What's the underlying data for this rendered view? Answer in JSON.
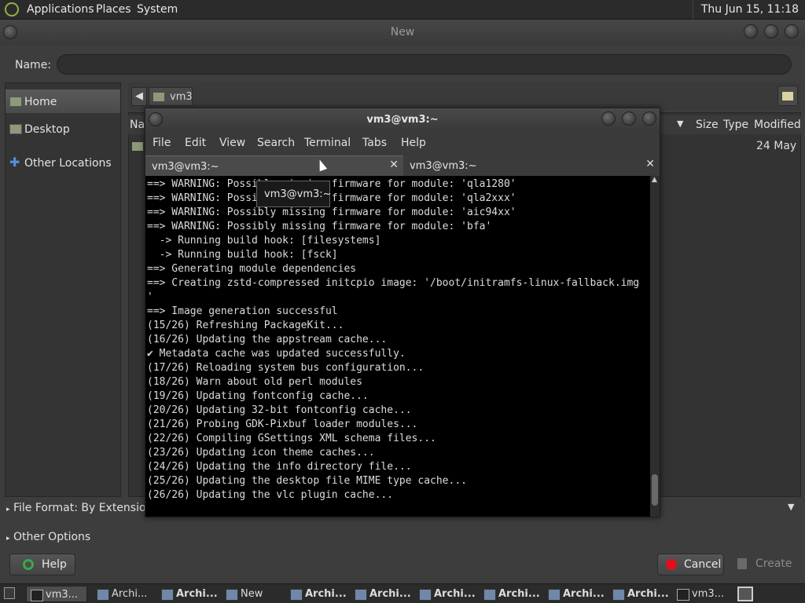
{
  "top_panel": {
    "menus": [
      "Applications",
      "Places",
      "System"
    ],
    "clock": "Thu Jun 15, 11:18"
  },
  "dialog": {
    "title": "New",
    "name_label": "Name:",
    "name_value": "",
    "places": [
      {
        "label": "Home",
        "selected": true
      },
      {
        "label": "Desktop",
        "selected": false
      },
      {
        "label": "Other Locations",
        "selected": false
      }
    ],
    "path_segment": "vm3",
    "columns": {
      "name": "Na",
      "size": "Size",
      "type": "Type",
      "modified": "Modified"
    },
    "file_row_modified": "24 May",
    "file_format_label": "File Format: By Extension",
    "other_options_label": "Other Options",
    "help_label": "Help",
    "cancel_label": "Cancel",
    "create_label": "Create"
  },
  "terminal": {
    "title": "vm3@vm3:~",
    "menus": [
      "File",
      "Edit",
      "View",
      "Search",
      "Terminal",
      "Tabs",
      "Help"
    ],
    "tabs": [
      {
        "label": "vm3@vm3:~",
        "active": true
      },
      {
        "label": "vm3@vm3:~",
        "active": false
      }
    ],
    "tooltip": "vm3@vm3:~",
    "lines": [
      "==> WARNING: Possibly missing firmware for module: 'qla1280'",
      "==> WARNING: Possibly missing firmware for module: 'qla2xxx'",
      "==> WARNING: Possibly missing firmware for module: 'aic94xx'",
      "==> WARNING: Possibly missing firmware for module: 'bfa'",
      "  -> Running build hook: [filesystems]",
      "  -> Running build hook: [fsck]",
      "==> Generating module dependencies",
      "==> Creating zstd-compressed initcpio image: '/boot/initramfs-linux-fallback.img",
      "'",
      "==> Image generation successful",
      "(15/26) Refreshing PackageKit...",
      "(16/26) Updating the appstream cache...",
      "✔ Metadata cache was updated successfully.",
      "(17/26) Reloading system bus configuration...",
      "(18/26) Warn about old perl modules",
      "(19/26) Updating fontconfig cache...",
      "(20/26) Updating 32-bit fontconfig cache...",
      "(21/26) Probing GDK-Pixbuf loader modules...",
      "(22/26) Compiling GSettings XML schema files...",
      "(23/26) Updating icon theme caches...",
      "(24/26) Updating the info directory file...",
      "(25/26) Updating the desktop file MIME type cache...",
      "(26/26) Updating the vlc plugin cache..."
    ]
  },
  "taskbar": [
    {
      "label": "vm3...",
      "icon": "terminal-icon",
      "bold": false,
      "selected": true
    },
    {
      "label": "Archi...",
      "icon": "window-icon",
      "bold": false,
      "selected": false
    },
    {
      "label": "Archi...",
      "icon": "window-icon",
      "bold": true,
      "selected": false
    },
    {
      "label": "New",
      "icon": "window-icon",
      "bold": false,
      "selected": false
    },
    {
      "label": "Archi...",
      "icon": "window-icon",
      "bold": true,
      "selected": false
    },
    {
      "label": "Archi...",
      "icon": "window-icon",
      "bold": true,
      "selected": false
    },
    {
      "label": "Archi...",
      "icon": "window-icon",
      "bold": true,
      "selected": false
    },
    {
      "label": "Archi...",
      "icon": "window-icon",
      "bold": true,
      "selected": false
    },
    {
      "label": "Archi...",
      "icon": "window-icon",
      "bold": true,
      "selected": false
    },
    {
      "label": "Archi...",
      "icon": "window-icon",
      "bold": true,
      "selected": false
    },
    {
      "label": "vm3...",
      "icon": "terminal-icon",
      "bold": false,
      "selected": false
    }
  ],
  "colors": {
    "terminal_bg": "#000000",
    "cancel_icon": "#e0101a",
    "help_icon": "#3aa84a"
  }
}
